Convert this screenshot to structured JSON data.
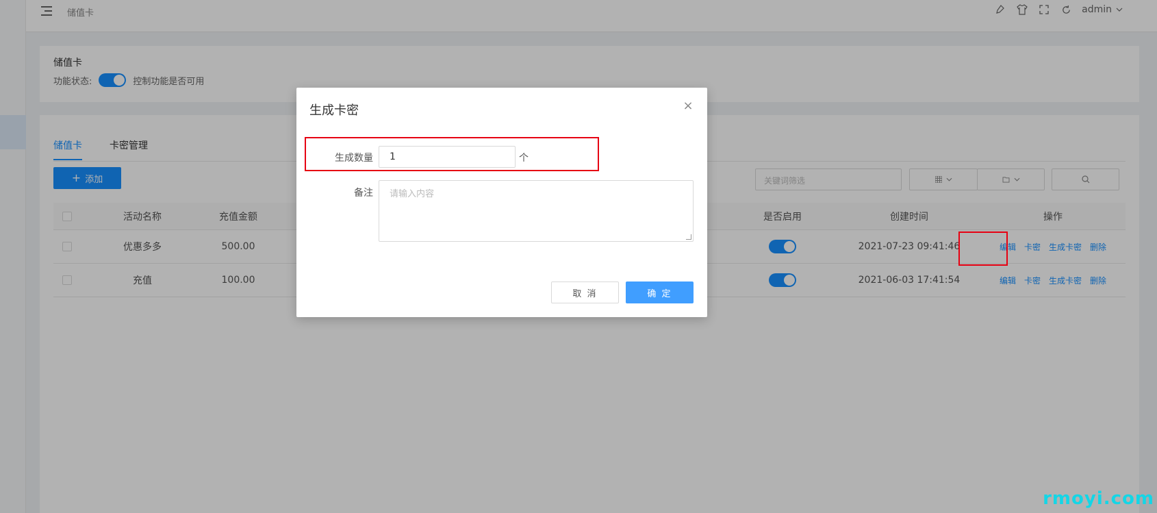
{
  "topbar": {
    "breadcrumb": "储值卡",
    "user": "admin"
  },
  "function_panel": {
    "title": "储值卡",
    "status_label": "功能状态:",
    "status_desc": "控制功能是否可用",
    "enabled": true
  },
  "tabs": [
    {
      "label": "储值卡",
      "active": true
    },
    {
      "label": "卡密管理",
      "active": false
    }
  ],
  "toolbar": {
    "add_label": "添加",
    "search_placeholder": "关键词筛选"
  },
  "table": {
    "columns": [
      "活动名称",
      "充值金额",
      "是否启用",
      "创建时间",
      "操作"
    ],
    "rows": [
      {
        "name": "优惠多多",
        "amount": "500.00",
        "enabled": true,
        "created": "2021-07-23 09:41:46"
      },
      {
        "name": "充值",
        "amount": "100.00",
        "enabled": true,
        "created": "2021-06-03 17:41:54"
      }
    ],
    "ops": [
      "编辑",
      "卡密",
      "生成卡密",
      "删除"
    ]
  },
  "modal": {
    "title": "生成卡密",
    "qty_label": "生成数量",
    "qty_value": "1",
    "qty_unit": "个",
    "remark_label": "备注",
    "remark_placeholder": "请输入内容",
    "cancel_label": "取 消",
    "ok_label": "确 定"
  },
  "watermark": "rmoyi.com",
  "colors": {
    "primary": "#1890ff",
    "highlight": "#e60012",
    "watermark": "#14d6e6"
  }
}
